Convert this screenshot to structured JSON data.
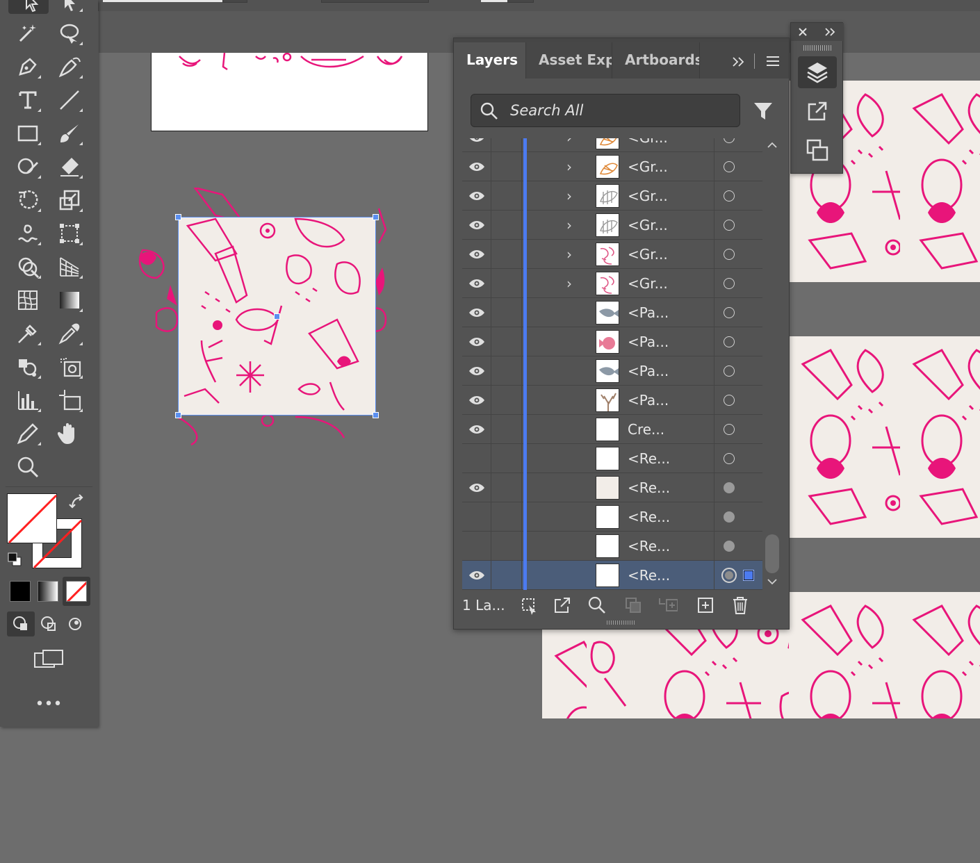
{
  "colors": {
    "pink": "#e8157a",
    "tile": "#f2ede8",
    "selection": "#5b8ff0",
    "layer_bar": "#4c7bf0"
  },
  "toolbar": {
    "icons": [
      "selection-tool-icon",
      "direct-selection-tool-icon",
      "magic-wand-icon",
      "lasso-icon",
      "pen-tool-icon",
      "curvature-tool-icon",
      "type-tool-icon",
      "line-segment-icon",
      "rectangle-tool-icon",
      "paintbrush-icon",
      "shaper-tool-icon",
      "eraser-icon",
      "rotate-tool-icon",
      "scale-tool-icon",
      "warp-tool-icon",
      "free-transform-icon",
      "shape-builder-icon",
      "perspective-grid-icon",
      "mesh-tool-icon",
      "gradient-tool-icon",
      "eyedropper-blend-icon",
      "eyedropper-icon",
      "symbol-sprayer-icon",
      "slice-icon",
      "column-graph-icon",
      "artboard-tool-icon",
      "pencil-icon",
      "hand-tool-icon",
      "zoom-tool-icon"
    ],
    "more_label": "•••"
  },
  "panel": {
    "tabs": [
      "Layers",
      "Asset Expo",
      "Artboards"
    ],
    "search_placeholder": "Search All",
    "footer_label": "1 La...",
    "rows": [
      {
        "label": "<Gr...",
        "eye": true,
        "chevron": true,
        "thumb": "orange",
        "target": "empty"
      },
      {
        "label": "<Gr...",
        "eye": true,
        "chevron": true,
        "thumb": "orange",
        "target": "empty"
      },
      {
        "label": "<Gr...",
        "eye": true,
        "chevron": true,
        "thumb": "gray",
        "target": "empty"
      },
      {
        "label": "<Gr...",
        "eye": true,
        "chevron": true,
        "thumb": "gray",
        "target": "empty"
      },
      {
        "label": "<Gr...",
        "eye": true,
        "chevron": true,
        "thumb": "pinkline",
        "target": "empty"
      },
      {
        "label": "<Gr...",
        "eye": true,
        "chevron": true,
        "thumb": "pinkline",
        "target": "empty"
      },
      {
        "label": "<Pa...",
        "eye": true,
        "chevron": false,
        "thumb": "grayfish",
        "target": "empty"
      },
      {
        "label": "<Pa...",
        "eye": true,
        "chevron": false,
        "thumb": "pinkfish",
        "target": "empty"
      },
      {
        "label": "<Pa...",
        "eye": true,
        "chevron": false,
        "thumb": "grayfish",
        "target": "empty"
      },
      {
        "label": "<Pa...",
        "eye": true,
        "chevron": false,
        "thumb": "coral",
        "target": "empty"
      },
      {
        "label": "Cre...",
        "eye": true,
        "chevron": false,
        "thumb": "white",
        "target": "empty"
      },
      {
        "label": "<Re...",
        "eye": false,
        "chevron": false,
        "thumb": "white",
        "target": "empty"
      },
      {
        "label": "<Re...",
        "eye": true,
        "chevron": false,
        "thumb": "cream",
        "target": "filled"
      },
      {
        "label": "<Re...",
        "eye": false,
        "chevron": false,
        "thumb": "white",
        "target": "filled"
      },
      {
        "label": "<Re...",
        "eye": false,
        "chevron": false,
        "thumb": "white",
        "target": "filled"
      },
      {
        "label": "<Re...",
        "eye": true,
        "chevron": false,
        "thumb": "white",
        "target": "ring",
        "selected": true
      }
    ]
  }
}
